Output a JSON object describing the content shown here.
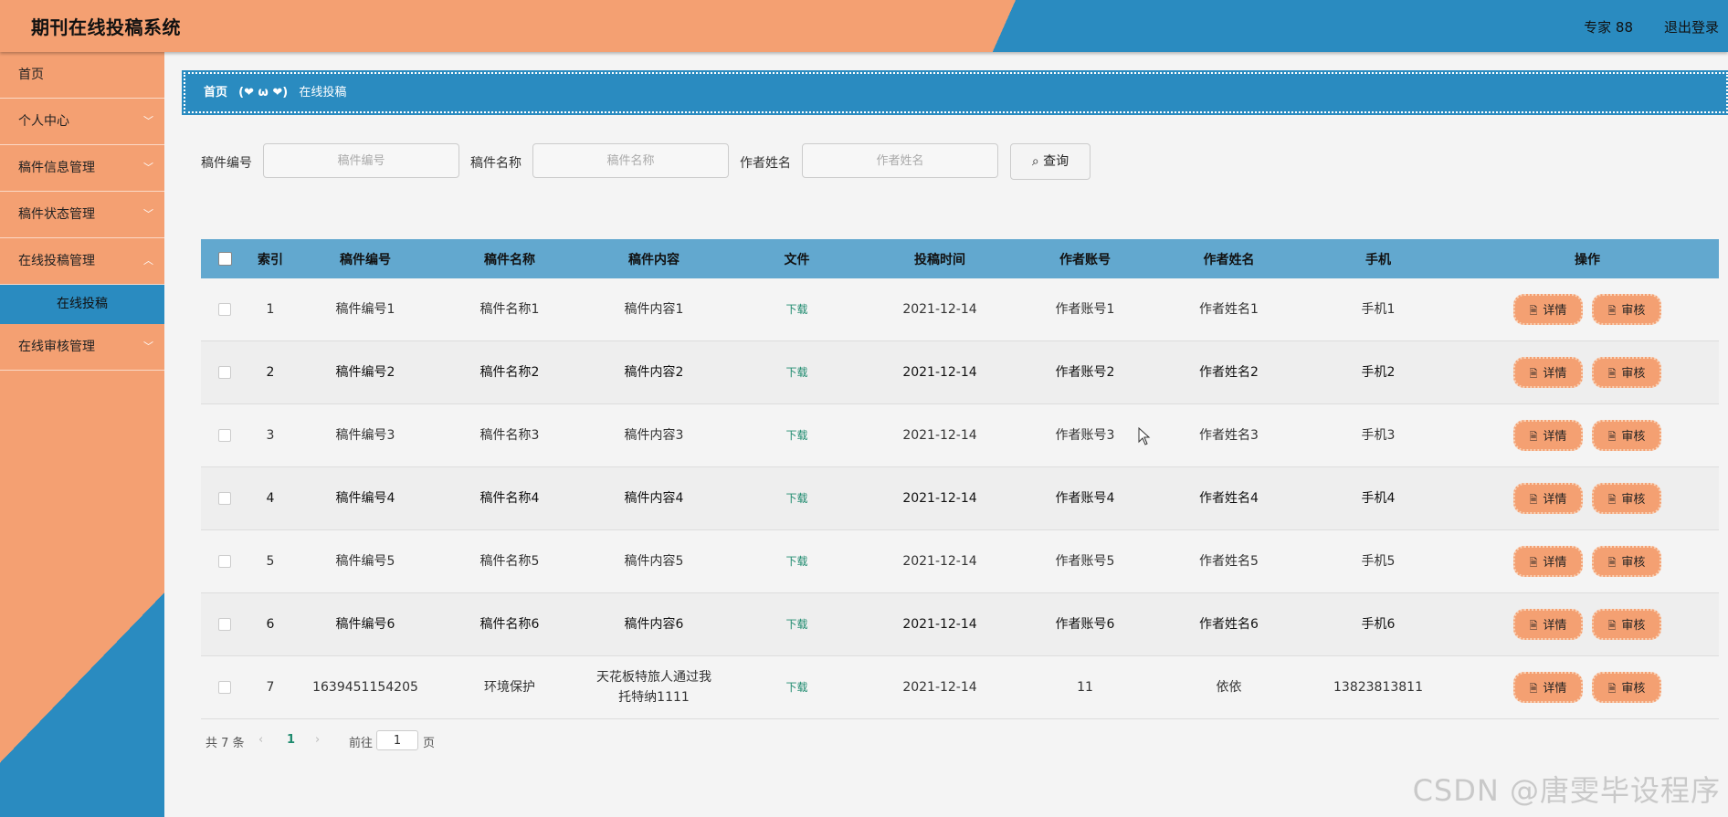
{
  "header": {
    "title": "期刊在线投稿系统",
    "user": "专家 88",
    "logout": "退出登录"
  },
  "sidebar": {
    "items": [
      {
        "label": "首页"
      },
      {
        "label": "个人中心"
      },
      {
        "label": "稿件信息管理"
      },
      {
        "label": "稿件状态管理"
      },
      {
        "label": "在线投稿管理"
      },
      {
        "label": "在线投稿",
        "sub": true
      },
      {
        "label": "在线审核管理"
      }
    ]
  },
  "breadcrumb": {
    "home": "首页",
    "separator": "(❤ ω ❤)",
    "current": "在线投稿"
  },
  "search": {
    "fields": [
      {
        "label": "稿件编号",
        "placeholder": "稿件编号"
      },
      {
        "label": "稿件名称",
        "placeholder": "稿件名称"
      },
      {
        "label": "作者姓名",
        "placeholder": "作者姓名"
      }
    ],
    "button": "查询"
  },
  "table": {
    "headers": [
      "索引",
      "稿件编号",
      "稿件名称",
      "稿件内容",
      "文件",
      "投稿时间",
      "作者账号",
      "作者姓名",
      "手机",
      "操作"
    ],
    "rows": [
      {
        "index": "1",
        "code": "稿件编号1",
        "name": "稿件名称1",
        "content": "稿件内容1",
        "file": "下载",
        "time": "2021-12-14",
        "account": "作者账号1",
        "author": "作者姓名1",
        "phone": "手机1"
      },
      {
        "index": "2",
        "code": "稿件编号2",
        "name": "稿件名称2",
        "content": "稿件内容2",
        "file": "下载",
        "time": "2021-12-14",
        "account": "作者账号2",
        "author": "作者姓名2",
        "phone": "手机2"
      },
      {
        "index": "3",
        "code": "稿件编号3",
        "name": "稿件名称3",
        "content": "稿件内容3",
        "file": "下载",
        "time": "2021-12-14",
        "account": "作者账号3",
        "author": "作者姓名3",
        "phone": "手机3"
      },
      {
        "index": "4",
        "code": "稿件编号4",
        "name": "稿件名称4",
        "content": "稿件内容4",
        "file": "下载",
        "time": "2021-12-14",
        "account": "作者账号4",
        "author": "作者姓名4",
        "phone": "手机4"
      },
      {
        "index": "5",
        "code": "稿件编号5",
        "name": "稿件名称5",
        "content": "稿件内容5",
        "file": "下载",
        "time": "2021-12-14",
        "account": "作者账号5",
        "author": "作者姓名5",
        "phone": "手机5"
      },
      {
        "index": "6",
        "code": "稿件编号6",
        "name": "稿件名称6",
        "content": "稿件内容6",
        "file": "下载",
        "time": "2021-12-14",
        "account": "作者账号6",
        "author": "作者姓名6",
        "phone": "手机6"
      },
      {
        "index": "7",
        "code": "1639451154205",
        "name": "环境保护",
        "content": "天花板特旅人通过我托特纳1111",
        "file": "下载",
        "time": "2021-12-14",
        "account": "11",
        "author": "依依",
        "phone": "13823813811"
      }
    ],
    "actions": {
      "detail": "详情",
      "review": "审核"
    }
  },
  "pagination": {
    "total": "共 7 条",
    "current_page": "1",
    "goto_label": "前往",
    "goto_value": "1",
    "page_suffix": "页"
  },
  "watermark": "CSDN @唐雯毕设程序",
  "colors": {
    "accent_orange": "#f4a072",
    "accent_blue": "#2a8bc0",
    "table_header": "#62a8cf",
    "link_green": "#1e8a6e"
  }
}
